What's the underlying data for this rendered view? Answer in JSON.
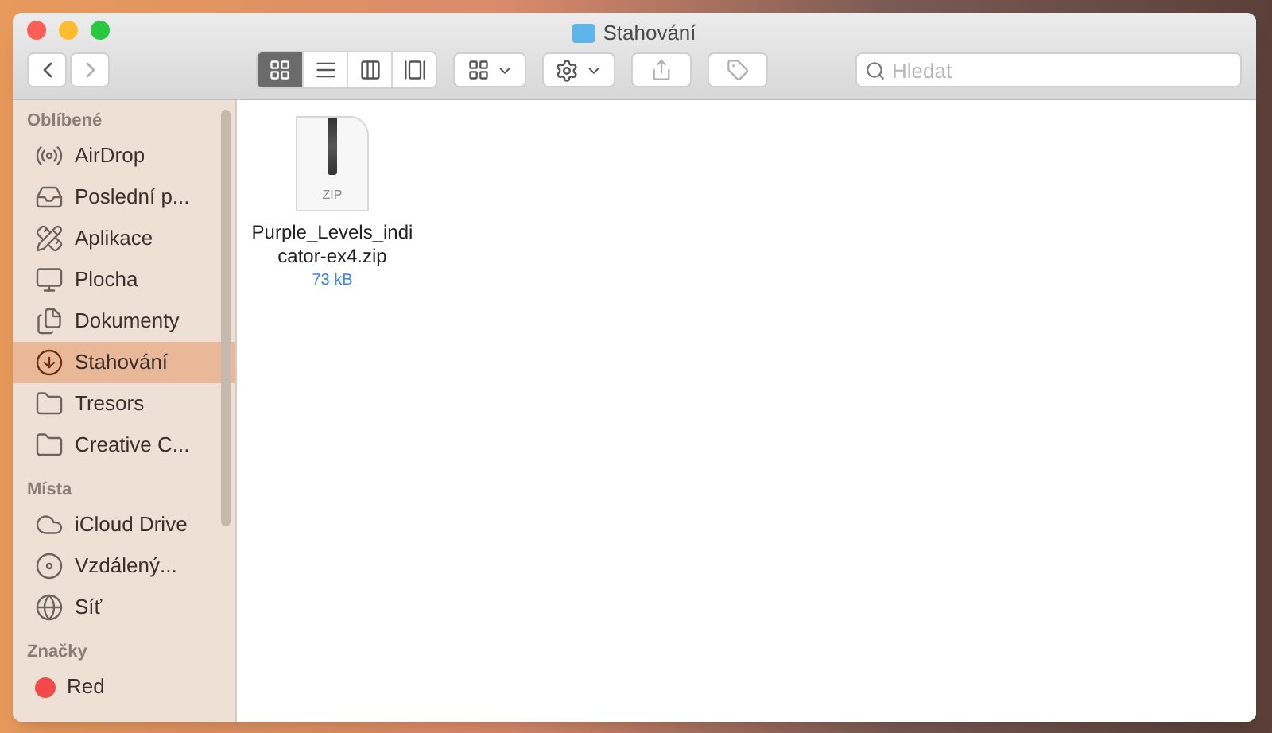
{
  "window": {
    "title": "Stahování"
  },
  "toolbar": {
    "back": {
      "disabled": false
    },
    "forward": {
      "disabled": true
    },
    "views": [
      {
        "kind": "icons",
        "selected": true
      },
      {
        "kind": "list",
        "selected": false
      },
      {
        "kind": "columns",
        "selected": false
      },
      {
        "kind": "gallery",
        "selected": false
      }
    ],
    "search": {
      "placeholder": "Hledat"
    }
  },
  "sidebar": [
    {
      "heading": "Oblíbené",
      "items": [
        {
          "label": "AirDrop",
          "kind": "airdrop",
          "selected": false
        },
        {
          "label": "Poslední p...",
          "kind": "recents",
          "selected": false
        },
        {
          "label": "Aplikace",
          "kind": "apps",
          "selected": false
        },
        {
          "label": "Plocha",
          "kind": "desktop",
          "selected": false
        },
        {
          "label": "Dokumenty",
          "kind": "documents",
          "selected": false
        },
        {
          "label": "Stahování",
          "kind": "downloads",
          "selected": true
        },
        {
          "label": "Tresors",
          "kind": "folder",
          "selected": false
        },
        {
          "label": "Creative C...",
          "kind": "folder",
          "selected": false
        }
      ]
    },
    {
      "heading": "Místa",
      "items": [
        {
          "label": "iCloud Drive",
          "kind": "cloud",
          "selected": false
        },
        {
          "label": "Vzdálený...",
          "kind": "disc",
          "selected": false
        },
        {
          "label": "Síť",
          "kind": "network",
          "selected": false
        }
      ]
    },
    {
      "heading": "Značky",
      "items": [
        {
          "label": "Red",
          "kind": "tag",
          "color": "#f2494b",
          "selected": false
        }
      ]
    }
  ],
  "files": [
    {
      "name": "Purple_Levels_indicator-ex4.zip",
      "badge": "ZIP",
      "size": "73 kB"
    }
  ]
}
